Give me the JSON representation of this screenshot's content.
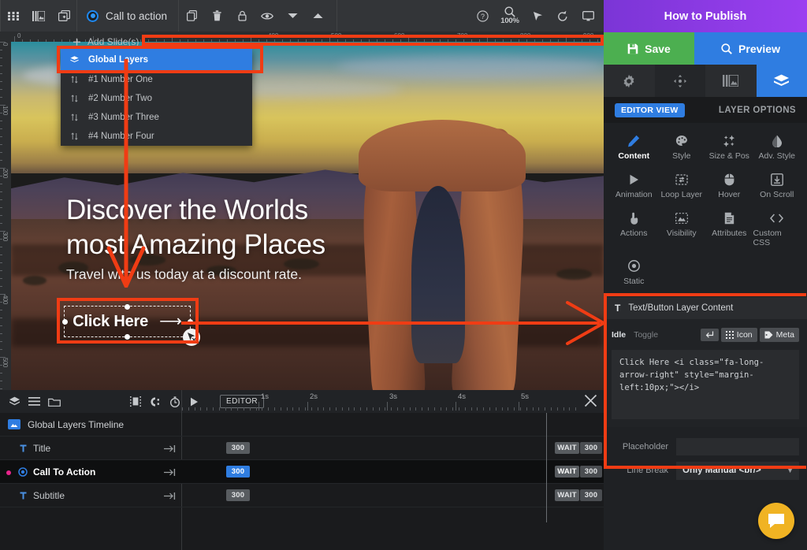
{
  "topbar": {
    "icons": [
      "grid-icon",
      "slide-strip-icon",
      "add-slide-icon"
    ],
    "slide_label": "Call to action",
    "action_icons": [
      "copy-icon",
      "trash-icon",
      "lock-icon",
      "eye-icon",
      "chevron-down-icon",
      "chevron-up-icon"
    ],
    "right_icons": [
      "help-icon",
      "zoom-icon",
      "cursor-icon",
      "undo-icon",
      "monitor-icon"
    ],
    "zoom_level": "100%"
  },
  "ruler": {
    "h_labels": [
      "0",
      "400",
      "500",
      "600",
      "700",
      "800",
      "900"
    ],
    "v_labels": [
      "0",
      "100",
      "200",
      "300",
      "400",
      "500"
    ]
  },
  "slide_dropdown": {
    "add_slide_label": "Add Slide(s)",
    "items": [
      {
        "label": "Global Layers",
        "icon": "layers-icon",
        "selected": true
      },
      {
        "label": "#1 Number One",
        "icon": "sort-icon",
        "selected": false
      },
      {
        "label": "#2 Number Two",
        "icon": "sort-icon",
        "selected": false
      },
      {
        "label": "#3 Number Three",
        "icon": "sort-icon",
        "selected": false
      },
      {
        "label": "#4 Number Four",
        "icon": "sort-icon",
        "selected": false
      }
    ]
  },
  "canvas": {
    "title_line1": "Discover the Worlds",
    "title_line2": "most Amazing Places",
    "subtitle": "Travel with us today at a discount rate.",
    "cta_text": "Click Here",
    "cta_arrow": "⟶"
  },
  "timeline": {
    "toolbar_icons": [
      "layers-icon",
      "list-icon",
      "folder-icon",
      "filmstrip-icon",
      "snap-icon",
      "stopwatch-icon",
      "play-icon"
    ],
    "editor_button": "EDITOR",
    "time_labels": [
      "1s",
      "2s",
      "3s",
      "4s",
      "5s"
    ],
    "group_label": "Global Layers Timeline",
    "rows": [
      {
        "name": "Title",
        "icon": "text-icon",
        "start_chip": "300",
        "wait_label": "WAIT",
        "end_chip": "300",
        "selected": false
      },
      {
        "name": "Call To Action",
        "icon": "radio-icon",
        "start_chip": "300",
        "wait_label": "WAIT",
        "end_chip": "300",
        "selected": true
      },
      {
        "name": "Subtitle",
        "icon": "text-icon",
        "start_chip": "300",
        "wait_label": "WAIT",
        "end_chip": "300",
        "selected": false
      }
    ],
    "close_icon": "close-icon"
  },
  "panel": {
    "title": "How to Publish",
    "save_label": "Save",
    "preview_label": "Preview",
    "tabs": [
      {
        "icon": "gear-icon",
        "active": false
      },
      {
        "icon": "move-icon",
        "active": false
      },
      {
        "icon": "slides-icon",
        "active": false
      },
      {
        "icon": "layers-icon",
        "active": true
      }
    ],
    "editor_view_label": "EDITOR VIEW",
    "layer_options_label": "LAYER OPTIONS",
    "options": [
      {
        "label": "Content",
        "icon": "pencil-icon",
        "active": true
      },
      {
        "label": "Style",
        "icon": "palette-icon",
        "active": false
      },
      {
        "label": "Size & Pos",
        "icon": "sparkle-icon",
        "active": false
      },
      {
        "label": "Adv. Style",
        "icon": "droplet-icon",
        "active": false
      },
      {
        "label": "Animation",
        "icon": "play-icon",
        "active": false
      },
      {
        "label": "Loop Layer",
        "icon": "loop-icon",
        "active": false
      },
      {
        "label": "Hover",
        "icon": "mouse-icon",
        "active": false
      },
      {
        "label": "On Scroll",
        "icon": "download-box-icon",
        "active": false
      },
      {
        "label": "Actions",
        "icon": "hand-pointer-icon",
        "active": false
      },
      {
        "label": "Visibility",
        "icon": "image-dashed-icon",
        "active": false
      },
      {
        "label": "Attributes",
        "icon": "document-icon",
        "active": false
      },
      {
        "label": "Custom CSS",
        "icon": "code-icon",
        "active": false
      },
      {
        "label": "Static",
        "icon": "circle-dot-icon",
        "active": false
      }
    ],
    "section": {
      "icon": "text-t-icon",
      "title": "Text/Button Layer Content",
      "mode_idle": "Idle",
      "mode_toggle": "Toggle",
      "btn_linebreak_icon": "return-arrow-icon",
      "btn_icon_label": "Icon",
      "btn_icon_glyph": "grid-dots-icon",
      "btn_meta_label": "Meta",
      "btn_meta_glyph": "tag-icon",
      "textarea_value": "Click Here <i class=\"fa-long-arrow-right\" style=\"margin-left:10px;\"></i>"
    },
    "placeholder_label": "Placeholder",
    "placeholder_value": "",
    "linebreak_label": "Line Break",
    "linebreak_value": "Only Manual <br/>",
    "chat_icon": "chat-bubble-icon"
  },
  "colors": {
    "accent_blue": "#2f7de1",
    "save_green": "#4caf50",
    "title_purple": "#8a2be2",
    "annotation_red": "#f03c14",
    "chat_yellow": "#f0b323"
  }
}
